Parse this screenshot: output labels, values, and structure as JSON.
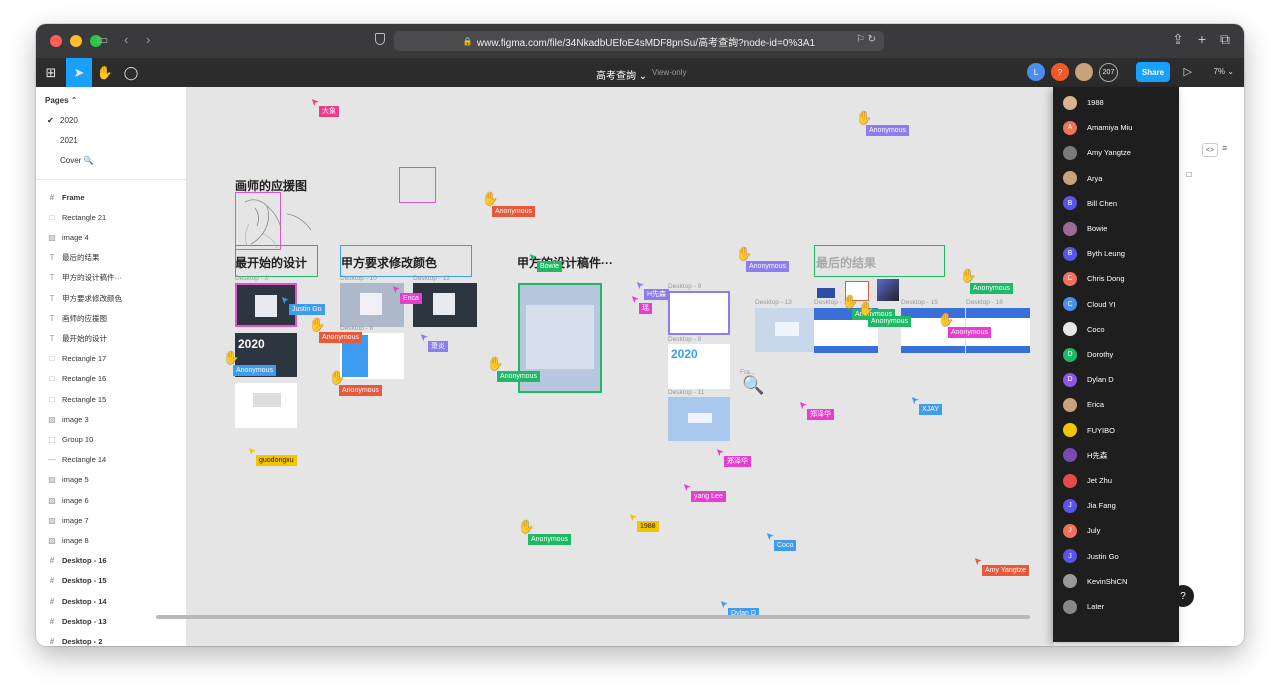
{
  "browser": {
    "url": "www.figma.com/file/34NkadbUEfoE4sMDF8pnSu/高考查詢?node-id=0%3A1"
  },
  "toolbar": {
    "file_title": "高考查詢 ⌄",
    "view_only": "View-only",
    "share_label": "Share",
    "zoom_label": "7% ⌄",
    "avatars": [
      {
        "initial": "L",
        "color": "#4a8ef0"
      },
      {
        "initial": "?",
        "color": "#f05a28"
      },
      {
        "initial": "",
        "color": "#c9a27b"
      }
    ],
    "avatar_count": "207"
  },
  "pages": {
    "header": "Pages ⌃",
    "items": [
      "2020",
      "2021",
      "Cover 🔍"
    ],
    "current": "2020"
  },
  "layers": [
    {
      "icon": "#",
      "label": "Frame",
      "bold": true
    },
    {
      "icon": "□",
      "label": "Rectangle 21"
    },
    {
      "icon": "▨",
      "label": "image 4"
    },
    {
      "icon": "T",
      "label": "最后的结果"
    },
    {
      "icon": "T",
      "label": "甲方的设计稿件···"
    },
    {
      "icon": "T",
      "label": "甲方要求修改颜色"
    },
    {
      "icon": "T",
      "label": "画师的应援图"
    },
    {
      "icon": "T",
      "label": "最开始的设计"
    },
    {
      "icon": "□",
      "label": "Rectangle 17"
    },
    {
      "icon": "□",
      "label": "Rectangle 16"
    },
    {
      "icon": "□",
      "label": "Rectangle 15"
    },
    {
      "icon": "▨",
      "label": "image 3"
    },
    {
      "icon": "⬚",
      "label": "Group 10"
    },
    {
      "icon": "—",
      "label": "Rectangle 14"
    },
    {
      "icon": "▨",
      "label": "image 5"
    },
    {
      "icon": "▨",
      "label": "image 6"
    },
    {
      "icon": "▨",
      "label": "image 7"
    },
    {
      "icon": "▨",
      "label": "image 8"
    },
    {
      "icon": "#",
      "label": "Desktop - 16",
      "bold": true
    },
    {
      "icon": "#",
      "label": "Desktop - 15",
      "bold": true
    },
    {
      "icon": "#",
      "label": "Desktop - 14",
      "bold": true
    },
    {
      "icon": "#",
      "label": "Desktop - 13",
      "bold": true
    },
    {
      "icon": "#",
      "label": "Desktop - 2",
      "bold": true
    }
  ],
  "canvas": {
    "titles": {
      "painter": "画师的应援图",
      "initial": "最开始的设计",
      "recolor": "甲方要求修改颜色",
      "client": "甲方的设计稿件···",
      "final": "最后的结果"
    },
    "frame_labels": {
      "d9": "Desktop - 9",
      "d8": "Desktop - 8",
      "d11": "Desktop - 11",
      "d13": "Desktop - 13",
      "d15": "Desktop - 15",
      "d16": "Desktop - 16",
      "fra": "Fra..."
    },
    "thumb_texts": {
      "year": "2020",
      "year2": "2020"
    },
    "cursors": [
      {
        "name": "大象",
        "color": "#e83e8c"
      },
      {
        "name": "Anonymous",
        "color": "#8b7cf0"
      },
      {
        "name": "Anonymous",
        "color": "#e8593c"
      },
      {
        "name": "Bowie",
        "color": "#1fb866"
      },
      {
        "name": "Anonymous",
        "color": "#8b7cf0"
      },
      {
        "name": "Anonymous",
        "color": "#1fb866"
      },
      {
        "name": "Justin Go",
        "color": "#3d9bf0"
      },
      {
        "name": "Erica",
        "color": "#e83ecf"
      },
      {
        "name": "H先森",
        "color": "#8b7cf0"
      },
      {
        "name": "瑶",
        "color": "#e83ecf"
      },
      {
        "name": "Anonymous",
        "color": "#1fb866"
      },
      {
        "name": "Anonymous",
        "color": "#e83ecf"
      },
      {
        "name": "Anonymous",
        "color": "#e8593c"
      },
      {
        "name": "萧炎",
        "color": "#8b7cf0"
      },
      {
        "name": "Anonymous",
        "color": "#3d9bf0"
      },
      {
        "name": "Anonymous",
        "color": "#e8593c"
      },
      {
        "name": "Anonymous",
        "color": "#1fb866"
      },
      {
        "name": "XJAY",
        "color": "#3d9bf0"
      },
      {
        "name": "郑泽华",
        "color": "#e83ecf"
      },
      {
        "name": "guodongxu",
        "color": "#f5c400"
      },
      {
        "name": "郑泽华",
        "color": "#e83ecf"
      },
      {
        "name": "yang Lee",
        "color": "#e83ecf"
      },
      {
        "name": "1988",
        "color": "#f5c400"
      },
      {
        "name": "Anonymous",
        "color": "#1fb866"
      },
      {
        "name": "Coco",
        "color": "#3d9bf0"
      },
      {
        "name": "Amy Yangtze",
        "color": "#e8593c"
      },
      {
        "name": "Dylan D",
        "color": "#3d9bf0"
      },
      {
        "name": "Anonymous",
        "color": "#1fb866"
      }
    ]
  },
  "multiplayer": [
    {
      "name": "1988",
      "initial": "",
      "color": "#d9b38c"
    },
    {
      "name": "Amamiya Miu",
      "initial": "A",
      "color": "#f0715a"
    },
    {
      "name": "Amy Yangtze",
      "initial": "",
      "color": "#7a7a7a"
    },
    {
      "name": "Arya",
      "initial": "",
      "color": "#c9a27b"
    },
    {
      "name": "Bill Chen",
      "initial": "B",
      "color": "#5a55e8"
    },
    {
      "name": "Bowie",
      "initial": "",
      "color": "#9c6b8f"
    },
    {
      "name": "Byth Leung",
      "initial": "B",
      "color": "#5a55e8"
    },
    {
      "name": "Chris Dong",
      "initial": "C",
      "color": "#f0715a"
    },
    {
      "name": "Cloud YI",
      "initial": "C",
      "color": "#4a8ef0"
    },
    {
      "name": "Coco",
      "initial": "",
      "color": "#e6e6e6"
    },
    {
      "name": "Dorothy",
      "initial": "D",
      "color": "#1fb866"
    },
    {
      "name": "Dylan D",
      "initial": "D",
      "color": "#8b55e8"
    },
    {
      "name": "Erica",
      "initial": "",
      "color": "#c9a27b"
    },
    {
      "name": "FUYIBO",
      "initial": "",
      "color": "#f5c400"
    },
    {
      "name": "H先森",
      "initial": "",
      "color": "#7a4ab0"
    },
    {
      "name": "Jet Zhu",
      "initial": "",
      "color": "#e84a4a"
    },
    {
      "name": "Jia Fang",
      "initial": "J",
      "color": "#5a55e8"
    },
    {
      "name": "July",
      "initial": "J",
      "color": "#f0715a"
    },
    {
      "name": "Justin Go",
      "initial": "J",
      "color": "#5a55e8"
    },
    {
      "name": "KevinShiCN",
      "initial": "",
      "color": "#999999"
    },
    {
      "name": "Later",
      "initial": "",
      "color": "#888888"
    }
  ]
}
